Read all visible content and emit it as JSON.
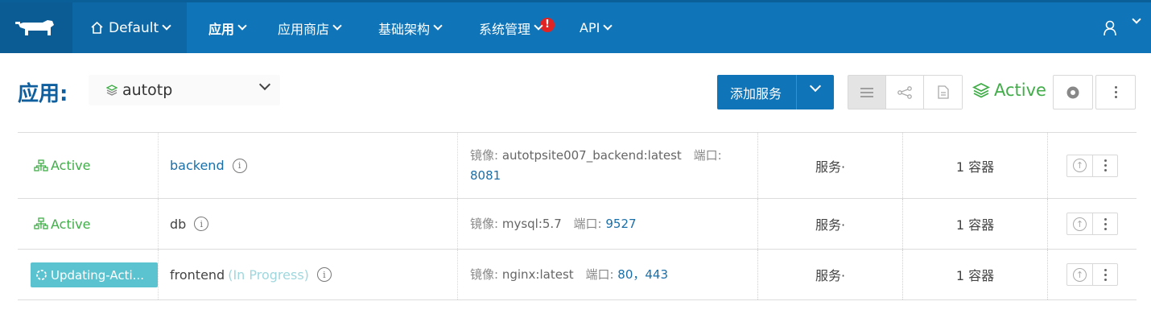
{
  "nav": {
    "environment": "Default",
    "items": [
      {
        "label": "应用"
      },
      {
        "label": "应用商店"
      },
      {
        "label": "基础架构"
      },
      {
        "label": "系统管理"
      },
      {
        "label": "API"
      }
    ],
    "alert_glyph": "!"
  },
  "header": {
    "title": "应用:",
    "app_name": "autotp",
    "add_service_label": "添加服务",
    "state_label": "Active"
  },
  "services": [
    {
      "state": "Active",
      "name": "backend",
      "name_suffix": "",
      "image_label": "镜像:",
      "image": "autotpsite007_backend:latest",
      "port_label": "端口:",
      "ports": "8081",
      "type": "服务·",
      "containers": "1 容器"
    },
    {
      "state": "Active",
      "name": "db",
      "name_suffix": "",
      "image_label": "镜像:",
      "image": "mysql:5.7",
      "port_label": "端口:",
      "ports": "9527",
      "type": "服务·",
      "containers": "1 容器"
    },
    {
      "state": "Updating-Acti...",
      "name": "frontend",
      "name_suffix": "(In Progress)",
      "image_label": "镜像:",
      "image": "nginx:latest",
      "port_label": "端口:",
      "ports": "80，443",
      "type": "服务·",
      "containers": "1 容器"
    }
  ],
  "icons": {
    "logo": "rancher-cow-logo",
    "env": "home-icon",
    "user": "user-icon",
    "info": "info-icon",
    "upgrade": "upgrade-icon",
    "more": "kebab-icon"
  },
  "colors": {
    "nav_bg": "#0f75b8",
    "active_green": "#41ad49",
    "updating_teal": "#5bc3cf",
    "link_blue": "#1a6fa8",
    "alert_red": "#e02424"
  }
}
